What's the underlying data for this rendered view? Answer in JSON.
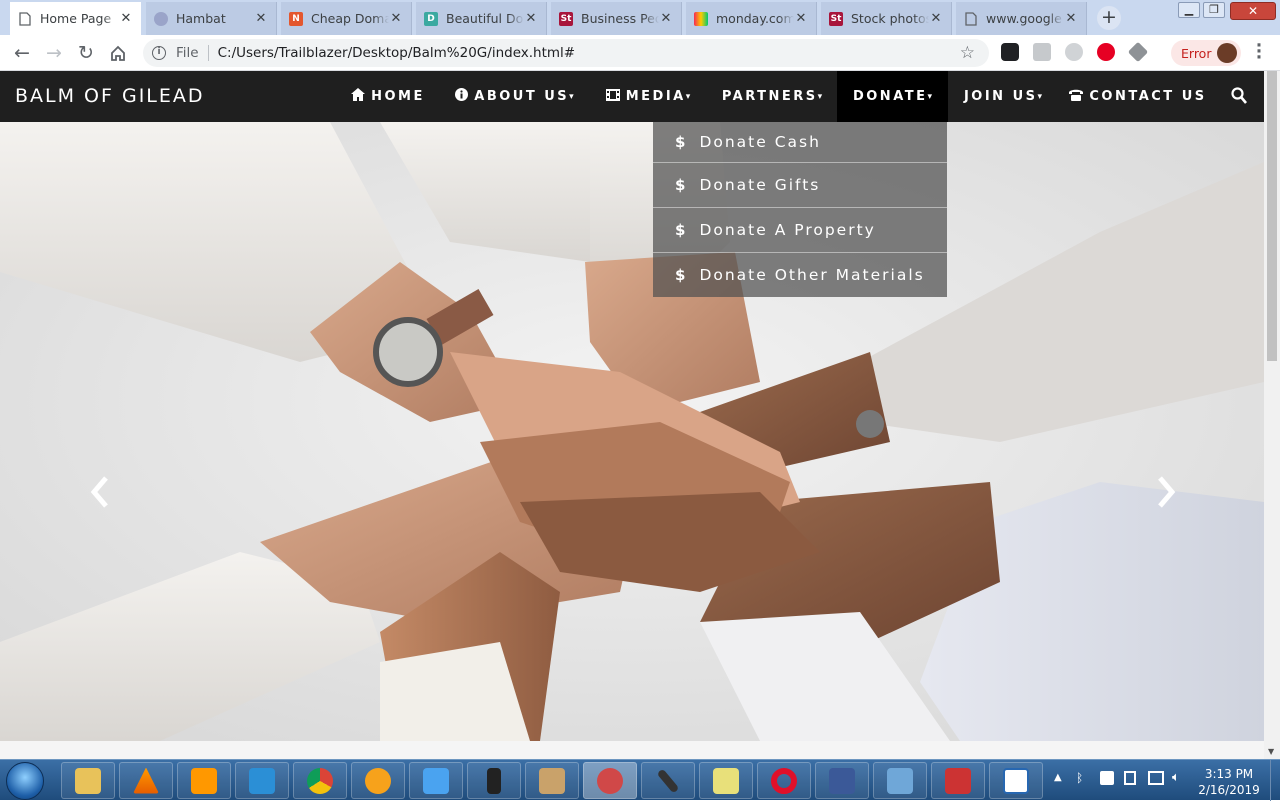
{
  "browser": {
    "tabs": [
      {
        "title": "Home Page",
        "active": true,
        "icon": "page-icon"
      },
      {
        "title": "Hambat",
        "active": false,
        "icon": "globe-icon"
      },
      {
        "title": "Cheap Doma",
        "active": false,
        "icon": "namecheap-icon"
      },
      {
        "title": "Beautiful Do",
        "active": false,
        "icon": "d-icon"
      },
      {
        "title": "Business Peo",
        "active": false,
        "icon": "st-icon"
      },
      {
        "title": "monday.com",
        "active": false,
        "icon": "monday-icon"
      },
      {
        "title": "Stock photos",
        "active": false,
        "icon": "st-icon"
      },
      {
        "title": "www.google",
        "active": false,
        "icon": "page-icon"
      }
    ],
    "file_label": "File",
    "url": "C:/Users/Trailblazer/Desktop/Balm%20G/index.html#",
    "error_label": "Error"
  },
  "site": {
    "brand": "BALM OF GILEAD",
    "nav": [
      {
        "label": "HOME",
        "icon": "home-icon",
        "caret": false
      },
      {
        "label": "ABOUT US",
        "icon": "info-icon",
        "caret": true
      },
      {
        "label": "MEDIA",
        "icon": "film-icon",
        "caret": true
      },
      {
        "label": "PARTNERS",
        "icon": "",
        "caret": true
      },
      {
        "label": "DONATE",
        "icon": "",
        "caret": true
      },
      {
        "label": "JOIN US",
        "icon": "",
        "caret": true
      },
      {
        "label": "CONTACT US",
        "icon": "phone-icon",
        "caret": false
      }
    ],
    "donate_menu": [
      {
        "label": "Donate Cash"
      },
      {
        "label": "Donate Gifts"
      },
      {
        "label": "Donate A Property"
      },
      {
        "label": "Donate Other Materials"
      }
    ],
    "carousel": {
      "slides": 5,
      "active_index": 3
    }
  },
  "taskbar": {
    "time": "3:13 PM",
    "date": "2/16/2019"
  }
}
